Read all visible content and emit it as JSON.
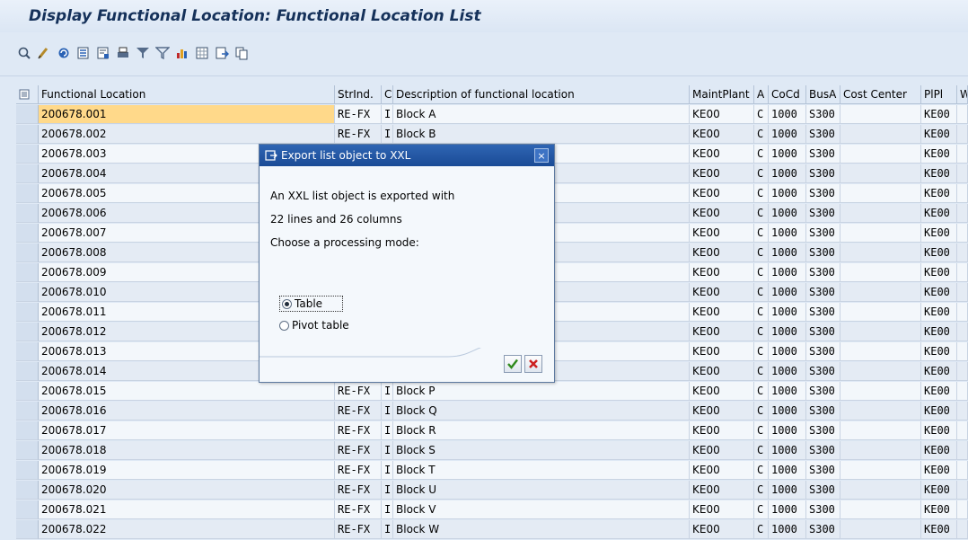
{
  "window": {
    "title": "Display Functional Location: Functional Location List"
  },
  "toolbar": {
    "icons": [
      "details-icon",
      "edit-icon",
      "refresh-icon",
      "select-layout-icon",
      "save-layout-icon",
      "print-icon",
      "filter-icon",
      "set-filter-icon",
      "chart-icon",
      "spreadsheet-icon",
      "export-icon",
      "copy-icon"
    ]
  },
  "table": {
    "columns": [
      "Functional Location",
      "StrInd.",
      "C",
      "Description of functional location",
      "MaintPlant",
      "A",
      "CoCd",
      "BusA",
      "Cost Center",
      "PlPl",
      "W"
    ],
    "rows": [
      [
        "200678.001",
        "RE-FX",
        "I",
        "Block A",
        "KE00",
        "C",
        "1000",
        "S300",
        "",
        "KE00"
      ],
      [
        "200678.002",
        "RE-FX",
        "I",
        "Block B",
        "KE00",
        "C",
        "1000",
        "S300",
        "",
        "KE00"
      ],
      [
        "200678.003",
        "",
        "",
        "",
        "KE00",
        "C",
        "1000",
        "S300",
        "",
        "KE00"
      ],
      [
        "200678.004",
        "",
        "",
        "",
        "KE00",
        "C",
        "1000",
        "S300",
        "",
        "KE00"
      ],
      [
        "200678.005",
        "",
        "",
        "",
        "KE00",
        "C",
        "1000",
        "S300",
        "",
        "KE00"
      ],
      [
        "200678.006",
        "",
        "",
        "",
        "KE00",
        "C",
        "1000",
        "S300",
        "",
        "KE00"
      ],
      [
        "200678.007",
        "",
        "",
        "",
        "KE00",
        "C",
        "1000",
        "S300",
        "",
        "KE00"
      ],
      [
        "200678.008",
        "",
        "",
        "",
        "KE00",
        "C",
        "1000",
        "S300",
        "",
        "KE00"
      ],
      [
        "200678.009",
        "",
        "",
        "",
        "KE00",
        "C",
        "1000",
        "S300",
        "",
        "KE00"
      ],
      [
        "200678.010",
        "",
        "",
        "",
        "KE00",
        "C",
        "1000",
        "S300",
        "",
        "KE00"
      ],
      [
        "200678.011",
        "",
        "",
        "",
        "KE00",
        "C",
        "1000",
        "S300",
        "",
        "KE00"
      ],
      [
        "200678.012",
        "",
        "",
        "",
        "KE00",
        "C",
        "1000",
        "S300",
        "",
        "KE00"
      ],
      [
        "200678.013",
        "",
        "",
        "",
        "KE00",
        "C",
        "1000",
        "S300",
        "",
        "KE00"
      ],
      [
        "200678.014",
        "",
        "",
        "",
        "KE00",
        "C",
        "1000",
        "S300",
        "",
        "KE00"
      ],
      [
        "200678.015",
        "RE-FX",
        "I",
        "Block P",
        "KE00",
        "C",
        "1000",
        "S300",
        "",
        "KE00"
      ],
      [
        "200678.016",
        "RE-FX",
        "I",
        "Block Q",
        "KE00",
        "C",
        "1000",
        "S300",
        "",
        "KE00"
      ],
      [
        "200678.017",
        "RE-FX",
        "I",
        "Block R",
        "KE00",
        "C",
        "1000",
        "S300",
        "",
        "KE00"
      ],
      [
        "200678.018",
        "RE-FX",
        "I",
        "Block S",
        "KE00",
        "C",
        "1000",
        "S300",
        "",
        "KE00"
      ],
      [
        "200678.019",
        "RE-FX",
        "I",
        "Block T",
        "KE00",
        "C",
        "1000",
        "S300",
        "",
        "KE00"
      ],
      [
        "200678.020",
        "RE-FX",
        "I",
        "Block U",
        "KE00",
        "C",
        "1000",
        "S300",
        "",
        "KE00"
      ],
      [
        "200678.021",
        "RE-FX",
        "I",
        "Block V",
        "KE00",
        "C",
        "1000",
        "S300",
        "",
        "KE00"
      ],
      [
        "200678.022",
        "RE-FX",
        "I",
        "Block W",
        "KE00",
        "C",
        "1000",
        "S300",
        "",
        "KE00"
      ]
    ]
  },
  "dialog": {
    "title": "Export list object to XXL",
    "close_label": "×",
    "line1": "An XXL list object is exported with",
    "line2": "22 lines and 26 columns",
    "line3": "Choose a processing mode:",
    "option_table": "Table",
    "option_pivot": "Pivot table",
    "selected": "Table"
  },
  "colors": {
    "title_text": "#15315a",
    "dialog_header": "#1a4b96",
    "highlight_cell": "#ffd98a"
  }
}
